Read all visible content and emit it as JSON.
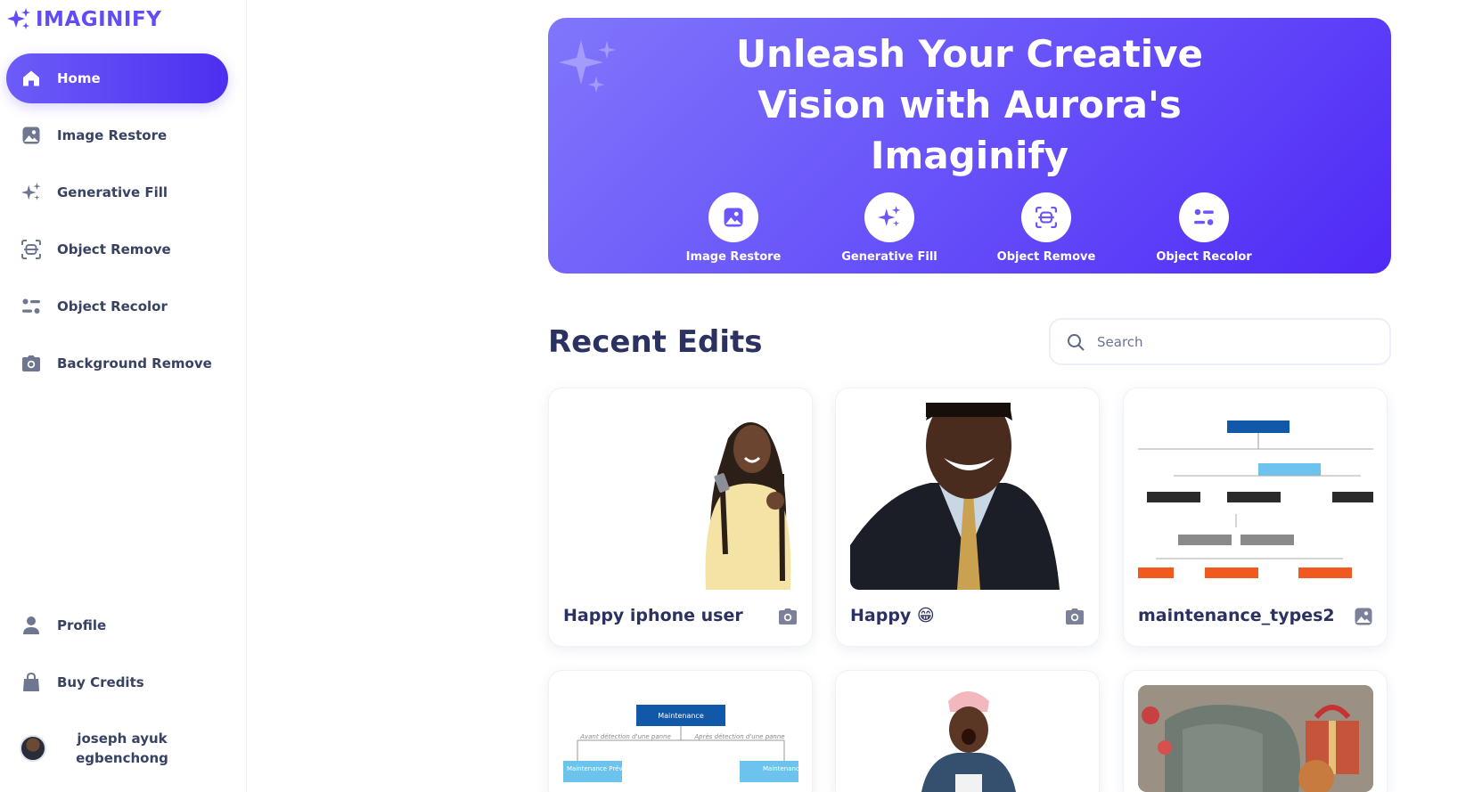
{
  "brand": {
    "logo_text": "IMAGINIFY",
    "accent": "#624cf5",
    "gradient_start": "#6d5cf8",
    "gradient_end": "#4c2ff0"
  },
  "sidebar": {
    "items": [
      {
        "label": "Home",
        "icon": "home-icon",
        "active": true
      },
      {
        "label": "Image Restore",
        "icon": "image-icon"
      },
      {
        "label": "Generative Fill",
        "icon": "sparkles-icon"
      },
      {
        "label": "Object Remove",
        "icon": "scan-icon"
      },
      {
        "label": "Object Recolor",
        "icon": "filter-icon"
      },
      {
        "label": "Background Remove",
        "icon": "camera-icon"
      }
    ],
    "bottom_items": [
      {
        "label": "Profile",
        "icon": "user-icon"
      },
      {
        "label": "Buy Credits",
        "icon": "bag-icon"
      }
    ],
    "user": {
      "name": "joseph ayuk egbenchong"
    }
  },
  "hero": {
    "title_lines": [
      "Unleash Your Creative",
      "Vision with Aurora's",
      "Imaginify"
    ],
    "tools": [
      {
        "label": "Image Restore",
        "icon": "image-icon"
      },
      {
        "label": "Generative Fill",
        "icon": "sparkles-icon"
      },
      {
        "label": "Object Remove",
        "icon": "scan-icon"
      },
      {
        "label": "Object Recolor",
        "icon": "filter-icon"
      }
    ]
  },
  "recent": {
    "title": "Recent Edits",
    "search_placeholder": "Search",
    "cards": [
      {
        "caption": "Happy iphone user",
        "type_icon": "camera-icon"
      },
      {
        "caption": "Happy 😁",
        "type_icon": "camera-icon"
      },
      {
        "caption": "maintenance_types2",
        "type_icon": "image-icon"
      },
      {
        "caption": "",
        "type_icon": ""
      },
      {
        "caption": "",
        "type_icon": ""
      },
      {
        "caption": "",
        "type_icon": ""
      }
    ],
    "diagram_labels": {
      "top": "Maintenance",
      "left_branch": "Avant détection d'une panne",
      "right_branch": "Après détection d'une panne",
      "left_box": "Maintenance Préventive",
      "right_box": "Maintenance Corrective"
    }
  }
}
